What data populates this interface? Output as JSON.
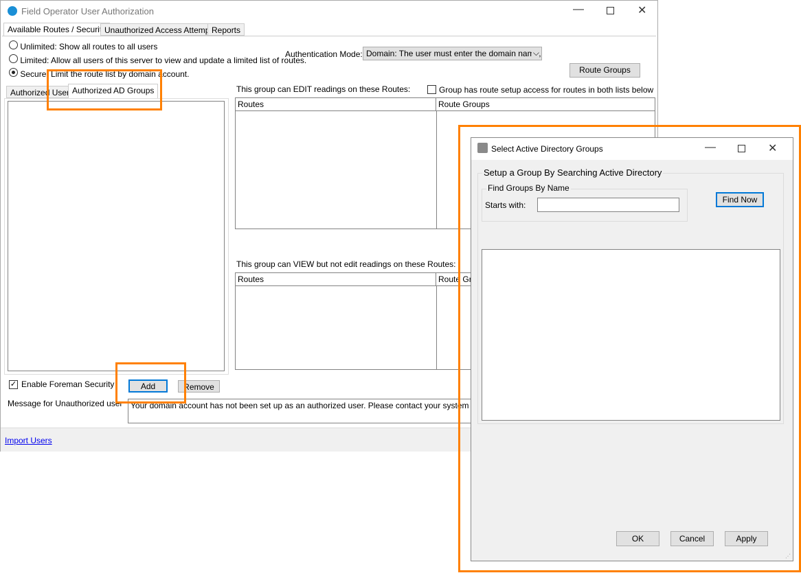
{
  "main_window": {
    "title": "Field Operator User Authorization",
    "icon": "app-user-shield-icon",
    "tabs": [
      {
        "label": "Available Routes / Security",
        "selected": true
      },
      {
        "label": "Unauthorized Access Attempts"
      },
      {
        "label": "Reports"
      }
    ],
    "radios": [
      {
        "label": "Unlimited: Show all routes to all users",
        "checked": false
      },
      {
        "label": "Limited: Allow all users of this server to view and update a limited list of routes.",
        "checked": false
      },
      {
        "label": "Secure: Limit the route list by domain account.",
        "checked": true
      }
    ],
    "auth_mode_label": "Authentication Mode:",
    "auth_mode_value": "Domain:  The user must enter the domain name, us",
    "route_groups_button": "Route Groups",
    "subtabs": [
      {
        "label": "Authorized Users"
      },
      {
        "label": "Authorized AD Groups",
        "selected": true
      }
    ],
    "edit_label": "This group can EDIT readings on these Routes:",
    "route_setup_checkbox": "Group has route setup access for routes in both lists below",
    "edit_columns": [
      "Routes",
      "Route Groups"
    ],
    "view_label": "This group can VIEW but not edit readings on these Routes:",
    "view_columns": [
      "Routes",
      "Route Groups"
    ],
    "foreman_checkbox": "Enable Foreman Security",
    "add_button": "Add",
    "remove_button": "Remove",
    "message_label": "Message for Unauthorized user",
    "message_value": "Your domain account has not been set up as an authorized user.  Please contact your system administrator for access.",
    "import_link": "Import Users"
  },
  "dialog": {
    "title": "Select Active Directory Groups",
    "outer_group": "Setup a Group By Searching Active Directory",
    "inner_group": "Find Groups By Name",
    "starts_with_label": "Starts with:",
    "starts_with_value": "",
    "find_button": "Find Now",
    "ok_button": "OK",
    "cancel_button": "Cancel",
    "apply_button": "Apply"
  },
  "highlight_color": "#ff8000"
}
